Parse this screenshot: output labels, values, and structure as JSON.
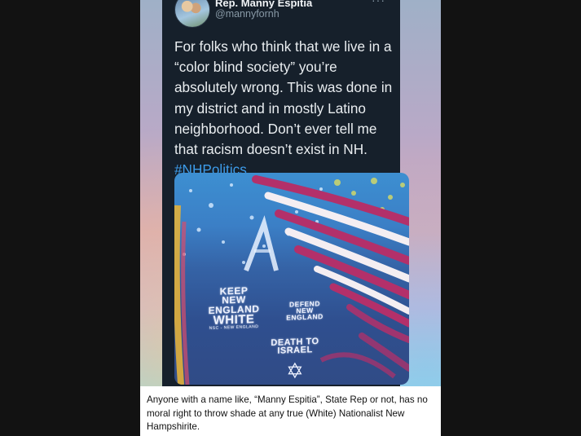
{
  "tweet": {
    "display_name": "Rep. Manny Espitia",
    "handle": "@mannyfornh",
    "more_icon": "more-horizontal-icon",
    "text": "For folks who think that we live in a “color blind society” you’re absolutely wrong. This was done in my district and in mostly Latino neighborhood. Don’t ever tell me that racism doesn’t exist in NH.",
    "hashtag": "#NHPolitics"
  },
  "photo": {
    "graffiti_1_line1": "KEEP",
    "graffiti_1_line2": "NEW",
    "graffiti_1_line3": "ENGLAND",
    "graffiti_1_line4": "WHITE",
    "graffiti_1_small": "NSC - NEW ENGLAND",
    "graffiti_2_line1": "DEFEND",
    "graffiti_2_line2": "NEW ENGLAND",
    "graffiti_3_line1": "DEATH TO",
    "graffiti_3_line2": "ISRAEL",
    "star_icon": "star-of-david-icon"
  },
  "caption": "Anyone with a name like, “Manny Espitia”, State Rep or not, has no moral right to throw shade at any true (White) Nationalist New Hampshirite."
}
